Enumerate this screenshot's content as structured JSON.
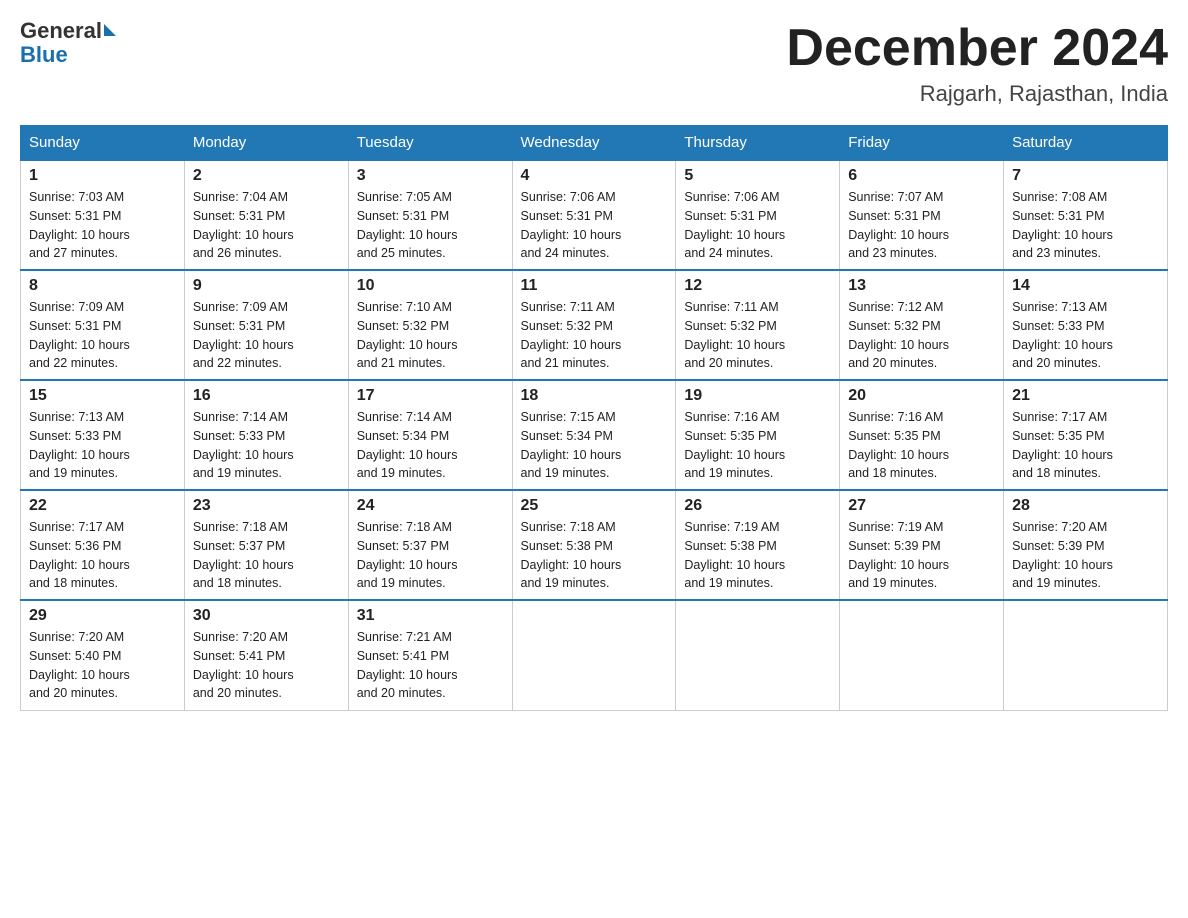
{
  "header": {
    "logo_text1": "General",
    "logo_text2": "Blue",
    "month_title": "December 2024",
    "location": "Rajgarh, Rajasthan, India"
  },
  "days_of_week": [
    "Sunday",
    "Monday",
    "Tuesday",
    "Wednesday",
    "Thursday",
    "Friday",
    "Saturday"
  ],
  "weeks": [
    [
      {
        "day": "1",
        "sunrise": "7:03 AM",
        "sunset": "5:31 PM",
        "daylight": "10 hours and 27 minutes."
      },
      {
        "day": "2",
        "sunrise": "7:04 AM",
        "sunset": "5:31 PM",
        "daylight": "10 hours and 26 minutes."
      },
      {
        "day": "3",
        "sunrise": "7:05 AM",
        "sunset": "5:31 PM",
        "daylight": "10 hours and 25 minutes."
      },
      {
        "day": "4",
        "sunrise": "7:06 AM",
        "sunset": "5:31 PM",
        "daylight": "10 hours and 24 minutes."
      },
      {
        "day": "5",
        "sunrise": "7:06 AM",
        "sunset": "5:31 PM",
        "daylight": "10 hours and 24 minutes."
      },
      {
        "day": "6",
        "sunrise": "7:07 AM",
        "sunset": "5:31 PM",
        "daylight": "10 hours and 23 minutes."
      },
      {
        "day": "7",
        "sunrise": "7:08 AM",
        "sunset": "5:31 PM",
        "daylight": "10 hours and 23 minutes."
      }
    ],
    [
      {
        "day": "8",
        "sunrise": "7:09 AM",
        "sunset": "5:31 PM",
        "daylight": "10 hours and 22 minutes."
      },
      {
        "day": "9",
        "sunrise": "7:09 AM",
        "sunset": "5:31 PM",
        "daylight": "10 hours and 22 minutes."
      },
      {
        "day": "10",
        "sunrise": "7:10 AM",
        "sunset": "5:32 PM",
        "daylight": "10 hours and 21 minutes."
      },
      {
        "day": "11",
        "sunrise": "7:11 AM",
        "sunset": "5:32 PM",
        "daylight": "10 hours and 21 minutes."
      },
      {
        "day": "12",
        "sunrise": "7:11 AM",
        "sunset": "5:32 PM",
        "daylight": "10 hours and 20 minutes."
      },
      {
        "day": "13",
        "sunrise": "7:12 AM",
        "sunset": "5:32 PM",
        "daylight": "10 hours and 20 minutes."
      },
      {
        "day": "14",
        "sunrise": "7:13 AM",
        "sunset": "5:33 PM",
        "daylight": "10 hours and 20 minutes."
      }
    ],
    [
      {
        "day": "15",
        "sunrise": "7:13 AM",
        "sunset": "5:33 PM",
        "daylight": "10 hours and 19 minutes."
      },
      {
        "day": "16",
        "sunrise": "7:14 AM",
        "sunset": "5:33 PM",
        "daylight": "10 hours and 19 minutes."
      },
      {
        "day": "17",
        "sunrise": "7:14 AM",
        "sunset": "5:34 PM",
        "daylight": "10 hours and 19 minutes."
      },
      {
        "day": "18",
        "sunrise": "7:15 AM",
        "sunset": "5:34 PM",
        "daylight": "10 hours and 19 minutes."
      },
      {
        "day": "19",
        "sunrise": "7:16 AM",
        "sunset": "5:35 PM",
        "daylight": "10 hours and 19 minutes."
      },
      {
        "day": "20",
        "sunrise": "7:16 AM",
        "sunset": "5:35 PM",
        "daylight": "10 hours and 18 minutes."
      },
      {
        "day": "21",
        "sunrise": "7:17 AM",
        "sunset": "5:35 PM",
        "daylight": "10 hours and 18 minutes."
      }
    ],
    [
      {
        "day": "22",
        "sunrise": "7:17 AM",
        "sunset": "5:36 PM",
        "daylight": "10 hours and 18 minutes."
      },
      {
        "day": "23",
        "sunrise": "7:18 AM",
        "sunset": "5:37 PM",
        "daylight": "10 hours and 18 minutes."
      },
      {
        "day": "24",
        "sunrise": "7:18 AM",
        "sunset": "5:37 PM",
        "daylight": "10 hours and 19 minutes."
      },
      {
        "day": "25",
        "sunrise": "7:18 AM",
        "sunset": "5:38 PM",
        "daylight": "10 hours and 19 minutes."
      },
      {
        "day": "26",
        "sunrise": "7:19 AM",
        "sunset": "5:38 PM",
        "daylight": "10 hours and 19 minutes."
      },
      {
        "day": "27",
        "sunrise": "7:19 AM",
        "sunset": "5:39 PM",
        "daylight": "10 hours and 19 minutes."
      },
      {
        "day": "28",
        "sunrise": "7:20 AM",
        "sunset": "5:39 PM",
        "daylight": "10 hours and 19 minutes."
      }
    ],
    [
      {
        "day": "29",
        "sunrise": "7:20 AM",
        "sunset": "5:40 PM",
        "daylight": "10 hours and 20 minutes."
      },
      {
        "day": "30",
        "sunrise": "7:20 AM",
        "sunset": "5:41 PM",
        "daylight": "10 hours and 20 minutes."
      },
      {
        "day": "31",
        "sunrise": "7:21 AM",
        "sunset": "5:41 PM",
        "daylight": "10 hours and 20 minutes."
      },
      null,
      null,
      null,
      null
    ]
  ],
  "labels": {
    "sunrise": "Sunrise: ",
    "sunset": "Sunset: ",
    "daylight": "Daylight: "
  }
}
